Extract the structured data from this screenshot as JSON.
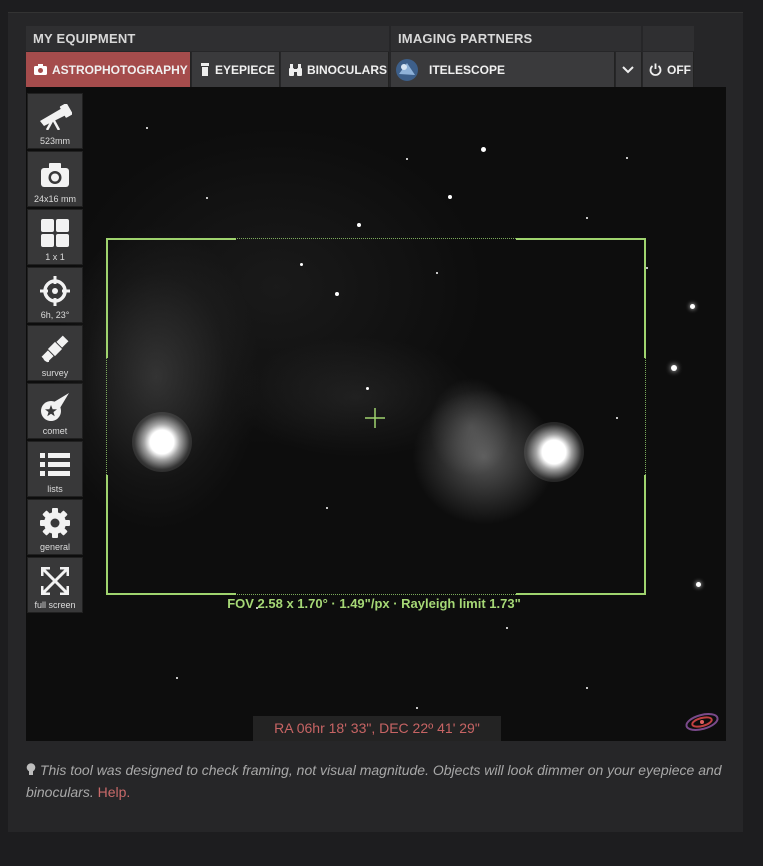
{
  "headers": {
    "equipment": "MY EQUIPMENT",
    "partners": "IMAGING PARTNERS"
  },
  "tabs": {
    "astro": "ASTROPHOTOGRAPHY",
    "eyepiece": "EYEPIECE",
    "binoculars": "BINOCULARS",
    "partner": "ITELESCOPE",
    "off": "OFF"
  },
  "sidebar": [
    {
      "label": "523mm",
      "icon": "telescope-icon"
    },
    {
      "label": "24x16 mm",
      "icon": "camera-icon"
    },
    {
      "label": "1 x 1",
      "icon": "grid-icon"
    },
    {
      "label": "6h, 23°",
      "icon": "crosshair-icon"
    },
    {
      "label": "survey",
      "icon": "satellite-icon"
    },
    {
      "label": "comet",
      "icon": "comet-icon"
    },
    {
      "label": "lists",
      "icon": "list-icon"
    },
    {
      "label": "general",
      "icon": "gear-icon"
    },
    {
      "label": "full screen",
      "icon": "fullscreen-icon"
    }
  ],
  "fov_text": "FOV 2.58 x 1.70° · 1.49\"/px · Rayleigh limit 1.73\"",
  "coords": "RA 06hr 18' 33\", DEC 22º 41' 29\"",
  "note": {
    "text": "This tool was designed to check framing, not visual magnitude. Objects will look dimmer on your eyepiece and binoculars.",
    "link": "Help."
  },
  "colors": {
    "active_tab": "#a54c4c",
    "fov": "#9fd36e",
    "coords": "#c76464"
  }
}
